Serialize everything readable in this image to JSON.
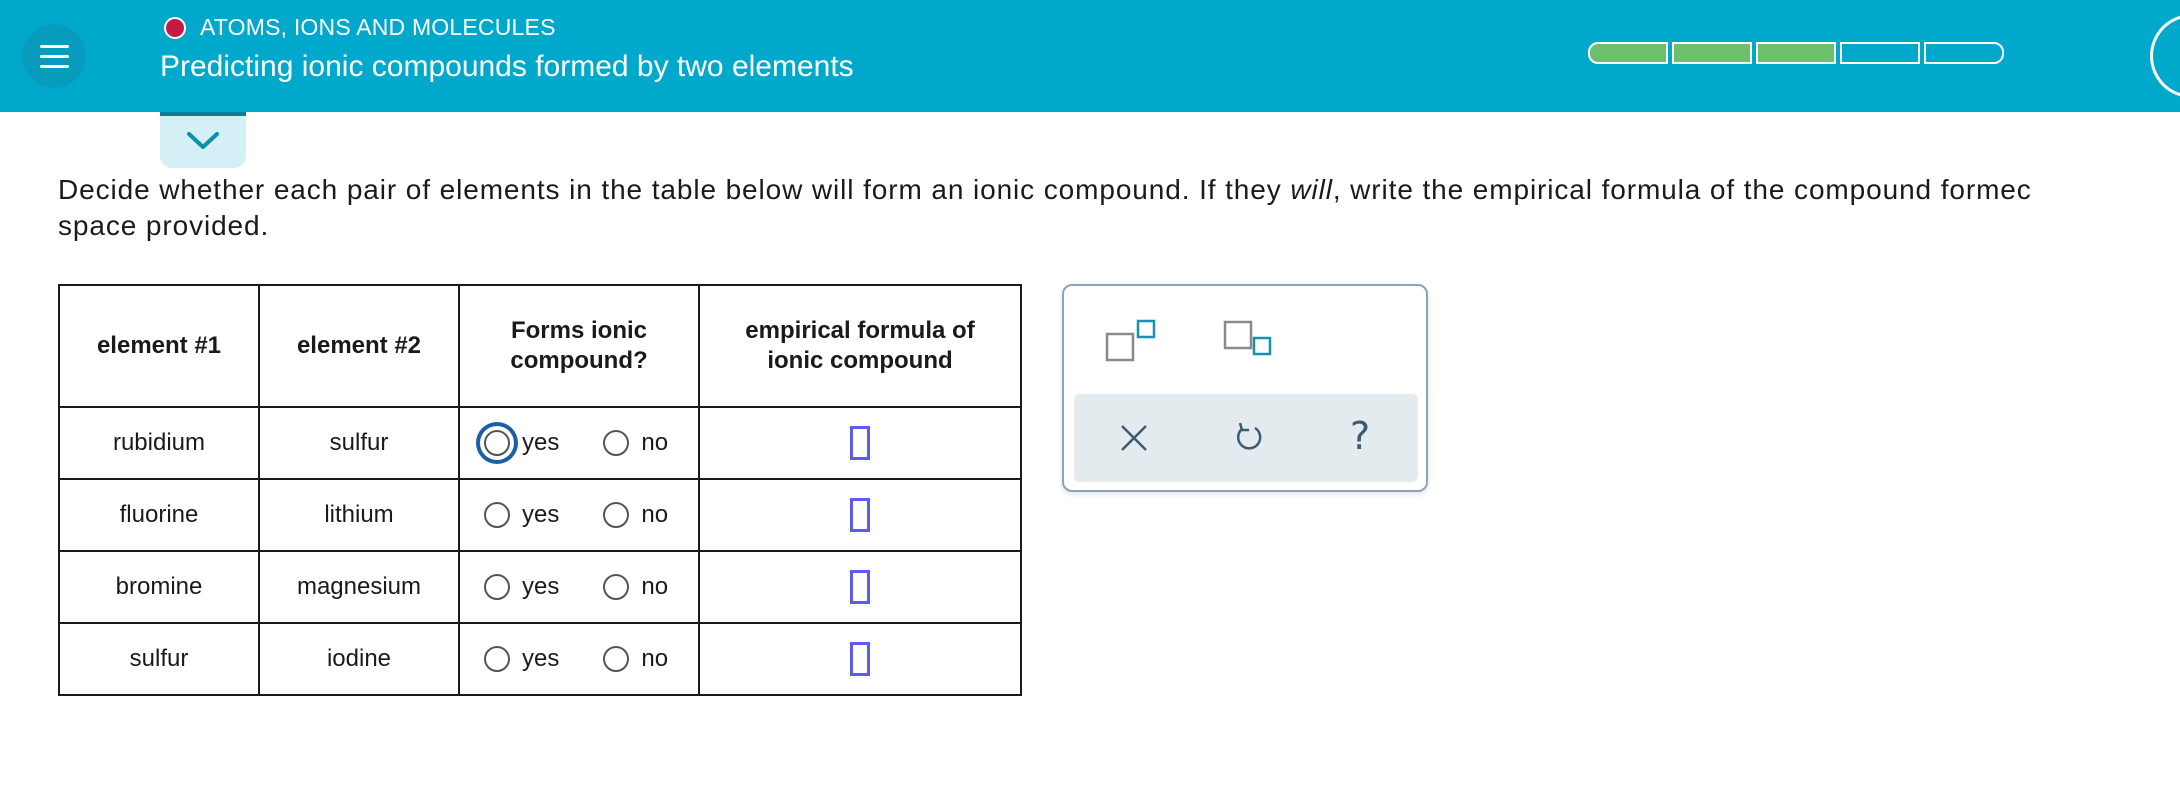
{
  "header": {
    "topic": "ATOMS, IONS AND MOLECULES",
    "title": "Predicting ionic compounds formed by two elements",
    "menu_icon": "hamburger-icon",
    "progress": {
      "segments_total": 5,
      "segments_filled": 3,
      "fill_color": "#6cbf6c"
    },
    "accent_color": "#00a9cc",
    "topic_dot_color": "#c21b45"
  },
  "question": {
    "text_before_italic": "Decide whether each pair of elements in the table below will form an ionic compound. If they ",
    "italic_word": "will",
    "text_after_italic": ", write the empirical formula of the compound formec",
    "line2": "space provided."
  },
  "table": {
    "headers": {
      "element1": "element #1",
      "element2": "element #2",
      "forms_line1": "Forms ionic",
      "forms_line2": "compound?",
      "formula_line1": "empirical formula of",
      "formula_line2": "ionic compound"
    },
    "yes_label": "yes",
    "no_label": "no",
    "rows": [
      {
        "element1": "rubidium",
        "element2": "sulfur"
      },
      {
        "element1": "fluorine",
        "element2": "lithium"
      },
      {
        "element1": "bromine",
        "element2": "magnesium"
      },
      {
        "element1": "sulfur",
        "element2": "iodine"
      }
    ]
  },
  "toolbox": {
    "tools": [
      "superscript-icon",
      "subscript-icon"
    ],
    "actions": [
      "clear-icon",
      "undo-icon",
      "help-icon"
    ],
    "help_label": "?"
  }
}
